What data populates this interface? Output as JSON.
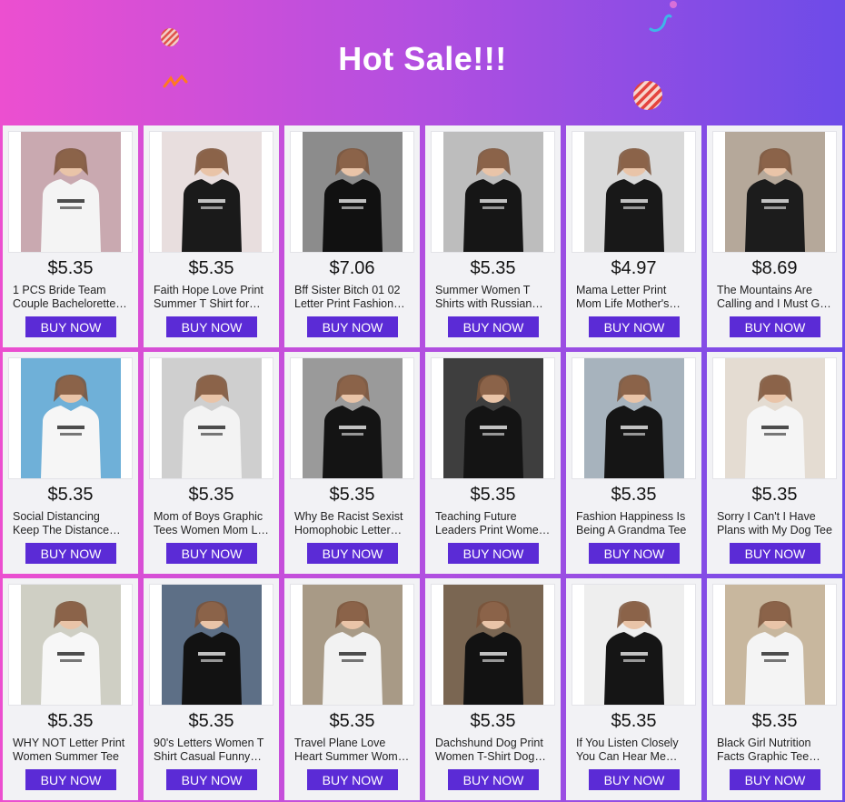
{
  "banner": {
    "title": "Hot Sale!!!",
    "colors": {
      "start": "#ec4fd0",
      "end": "#6d4be8",
      "button": "#5b2bd6"
    }
  },
  "products": [
    {
      "price": "$5.35",
      "title": "1 PCS Bride Team Couple Bachelorette Party T Shirt",
      "image": "bride-team-photo",
      "bg": "#c9a9b0",
      "shirt": "#f4f4f4"
    },
    {
      "price": "$5.35",
      "title": "Faith Hope Love Print Summer T Shirt for Women",
      "image": "faith-hope-love-photo",
      "bg": "#e8dede",
      "shirt": "#1a1a1a"
    },
    {
      "price": "$7.06",
      "title": "Bff Sister Bitch 01 02 Letter Print Fashion Tee",
      "image": "bitch-01-02-photo",
      "bg": "#8c8c8c",
      "shirt": "#111111"
    },
    {
      "price": "$5.35",
      "title": "Summer Women T Shirts with Russian Inscriptions",
      "image": "russian-inscription-photo",
      "bg": "#bdbdbd",
      "shirt": "#161616"
    },
    {
      "price": "$4.97",
      "title": "Mama Letter Print Mom Life Mother's Day Tee",
      "image": "mama-print-photo",
      "bg": "#d9d9d9",
      "shirt": "#181818"
    },
    {
      "price": "$8.69",
      "title": "The Mountains Are Calling and I Must Go Tee",
      "image": "mountains-calling-photo",
      "bg": "#b5a89a",
      "shirt": "#1c1c1c"
    },
    {
      "price": "$5.35",
      "title": "Social Distancing Keep The Distance Print Tee",
      "image": "social-distancing-photo",
      "bg": "#6fb0d8",
      "shirt": "#f6f6f6"
    },
    {
      "price": "$5.35",
      "title": "Mom of Boys Graphic Tees Women Mom Life Shirt",
      "image": "mom-of-boys-photo",
      "bg": "#cfcfcf",
      "shirt": "#f3f3f3"
    },
    {
      "price": "$5.35",
      "title": "Why Be Racist Sexist Homophobic Letter Tee",
      "image": "why-be-racist-photo",
      "bg": "#9a9a9a",
      "shirt": "#141414"
    },
    {
      "price": "$5.35",
      "title": "Teaching Future Leaders Print Women Tee",
      "image": "teaching-future-leaders-photo",
      "bg": "#3e3e3e",
      "shirt": "#141414"
    },
    {
      "price": "$5.35",
      "title": "Fashion Happiness Is Being A Grandma Tee",
      "image": "grandma-print-photo",
      "bg": "#a7b3bd",
      "shirt": "#151515"
    },
    {
      "price": "$5.35",
      "title": "Sorry I Can't I Have Plans with My Dog Tee",
      "image": "dog-plans-photo",
      "bg": "#e4dcd2",
      "shirt": "#f5f5f5"
    },
    {
      "price": "$5.35",
      "title": "WHY NOT Letter Print Women Summer Tee",
      "image": "why-not-photo",
      "bg": "#cfcfc4",
      "shirt": "#f7f7f7"
    },
    {
      "price": "$5.35",
      "title": "90's Letters Women T Shirt Casual Funny Tee",
      "image": "nineties-print-photo",
      "bg": "#5d6f86",
      "shirt": "#121212"
    },
    {
      "price": "$5.35",
      "title": "Travel Plane Love Heart Summer Women Tee",
      "image": "travel-heart-photo",
      "bg": "#a89a86",
      "shirt": "#f2f2f2"
    },
    {
      "price": "$5.35",
      "title": "Dachshund Dog Print Women T-Shirt Dog Lover Tee",
      "image": "dachshund-photo",
      "bg": "#7a6652",
      "shirt": "#121212"
    },
    {
      "price": "$5.35",
      "title": "If You Listen Closely You Can Hear Me Thinking Tee",
      "image": "listen-closely-photo",
      "bg": "#eeeeee",
      "shirt": "#151515"
    },
    {
      "price": "$5.35",
      "title": "Black Girl Nutrition Facts Graphic Tee Women",
      "image": "nutrition-facts-photo",
      "bg": "#c8b79e",
      "shirt": "#f4f4f4"
    }
  ],
  "buy_label": "BUY NOW"
}
